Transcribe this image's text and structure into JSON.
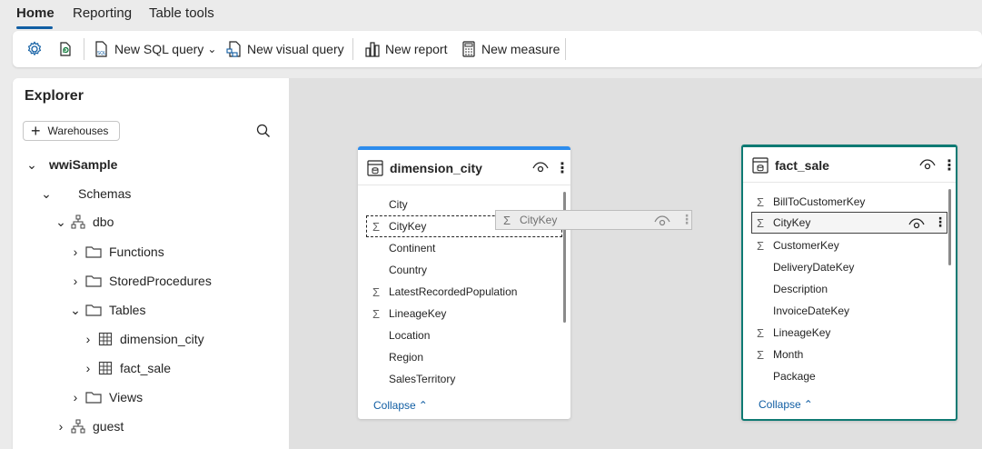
{
  "tabs": [
    {
      "label": "Home",
      "active": true
    },
    {
      "label": "Reporting",
      "active": false
    },
    {
      "label": "Table tools",
      "active": false
    }
  ],
  "toolbar": {
    "settings_icon": "settings-gear-icon",
    "refresh_icon": "refresh-icon",
    "new_sql_query": "New SQL query",
    "new_visual_query": "New visual query",
    "new_report": "New report",
    "new_measure": "New measure"
  },
  "explorer": {
    "title": "Explorer",
    "warehouses_button": "Warehouses",
    "tree": [
      {
        "label": "wwiSample",
        "level": 0,
        "expanded": true
      },
      {
        "label": "Schemas",
        "level": 1,
        "expanded": true
      },
      {
        "label": "dbo",
        "level": 2,
        "expanded": true
      },
      {
        "label": "Functions",
        "level": 3,
        "expanded": false
      },
      {
        "label": "StoredProcedures",
        "level": 3,
        "expanded": false
      },
      {
        "label": "Tables",
        "level": 3,
        "expanded": true
      },
      {
        "label": "dimension_city",
        "level": 4,
        "expanded": false
      },
      {
        "label": "fact_sale",
        "level": 4,
        "expanded": false
      },
      {
        "label": "Views",
        "level": 3,
        "expanded": false
      },
      {
        "label": "guest",
        "level": 2,
        "expanded": false
      }
    ]
  },
  "tables": {
    "dimension_city": {
      "name": "dimension_city",
      "collapse_label": "Collapse",
      "columns": [
        {
          "name": "City",
          "sigma": false
        },
        {
          "name": "CityKey",
          "sigma": true
        },
        {
          "name": "Continent",
          "sigma": false
        },
        {
          "name": "Country",
          "sigma": false
        },
        {
          "name": "LatestRecordedPopulation",
          "sigma": true
        },
        {
          "name": "LineageKey",
          "sigma": true
        },
        {
          "name": "Location",
          "sigma": false
        },
        {
          "name": "Region",
          "sigma": false
        },
        {
          "name": "SalesTerritory",
          "sigma": false
        }
      ]
    },
    "fact_sale": {
      "name": "fact_sale",
      "collapse_label": "Collapse",
      "columns": [
        {
          "name": "BillToCustomerKey",
          "sigma": true
        },
        {
          "name": "CityKey",
          "sigma": true
        },
        {
          "name": "CustomerKey",
          "sigma": true
        },
        {
          "name": "DeliveryDateKey",
          "sigma": false
        },
        {
          "name": "Description",
          "sigma": false
        },
        {
          "name": "InvoiceDateKey",
          "sigma": false
        },
        {
          "name": "LineageKey",
          "sigma": true
        },
        {
          "name": "Month",
          "sigma": true
        },
        {
          "name": "Package",
          "sigma": false
        }
      ]
    }
  },
  "drag_ghost": {
    "label": "CityKey"
  },
  "colors": {
    "accent": "#115ea3",
    "dim_border": "#2d8ced",
    "fact_border": "#0e7a73"
  }
}
